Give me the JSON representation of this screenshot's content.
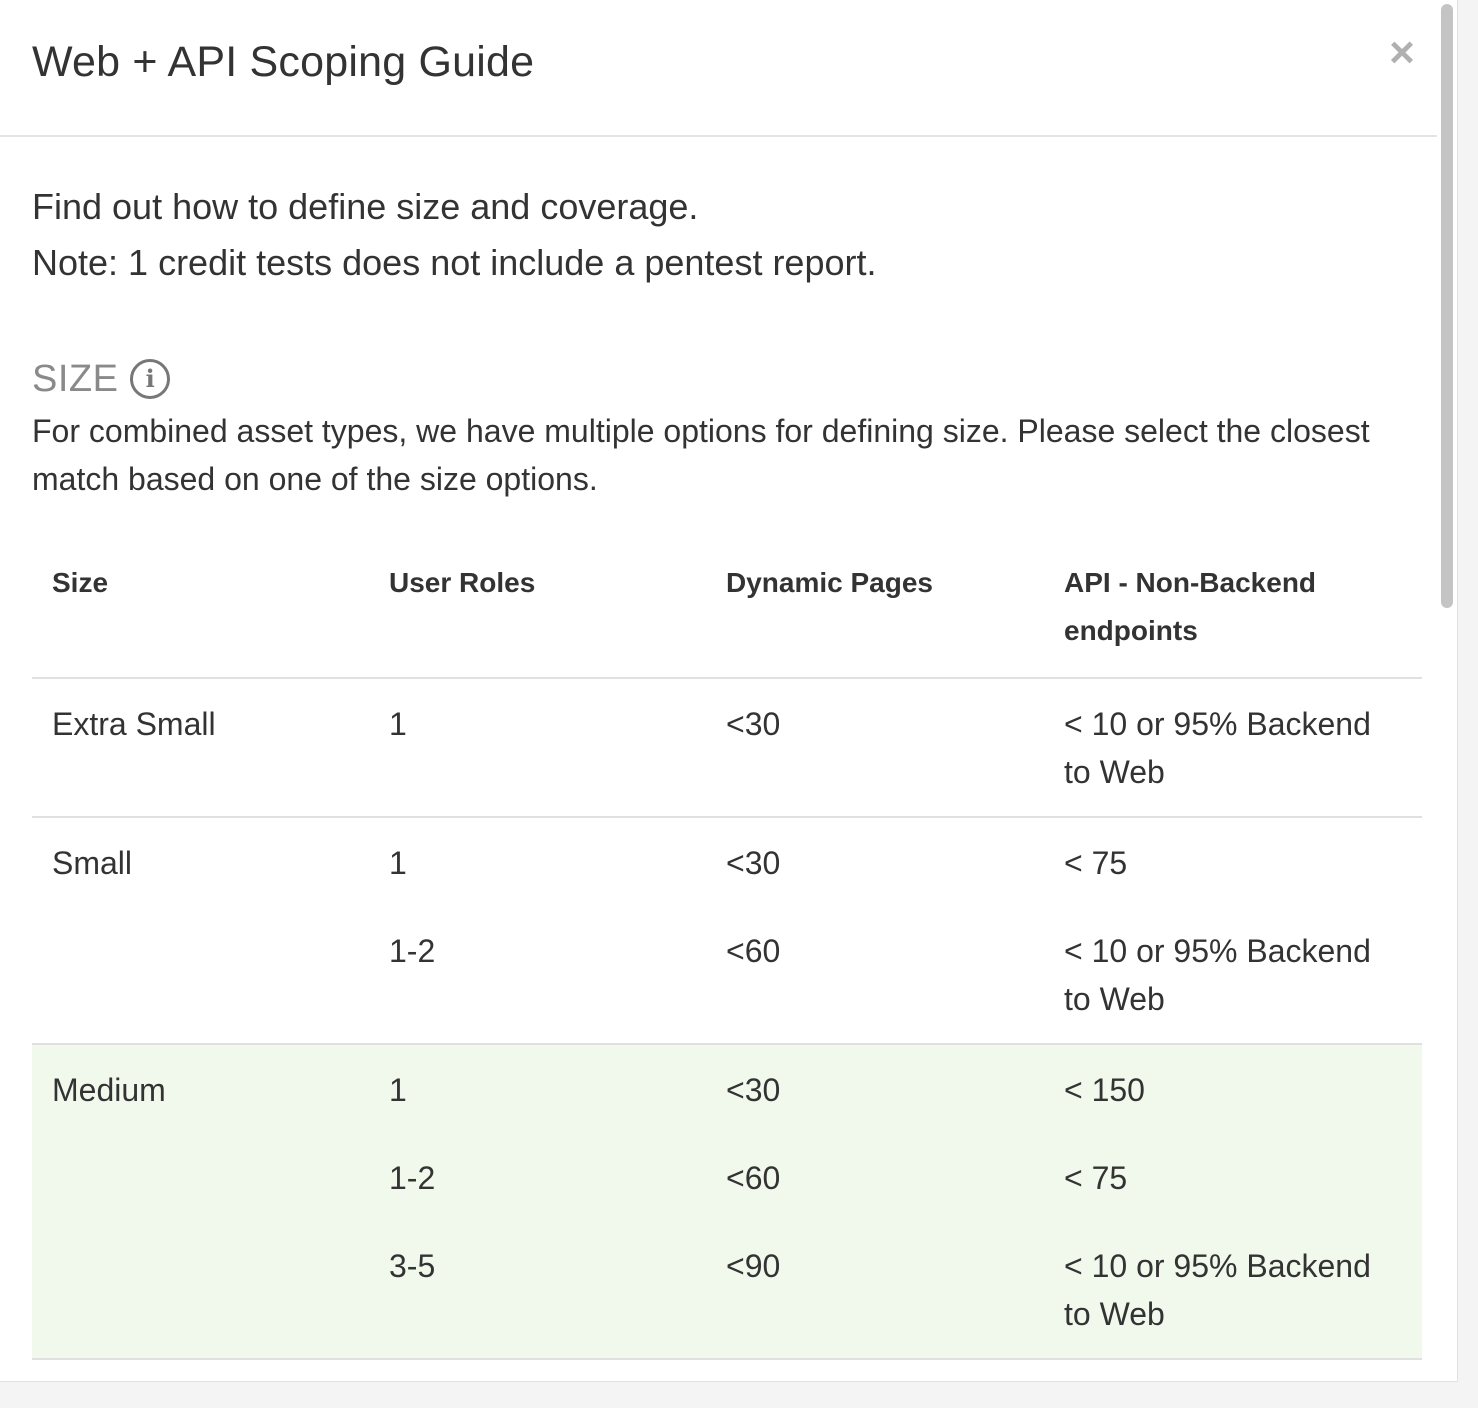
{
  "modal": {
    "title": "Web + API Scoping Guide",
    "close_label": "×"
  },
  "intro": {
    "line1": "Find out how to define size and coverage.",
    "line2": "Note: 1 credit tests does not include a pentest report."
  },
  "size_section": {
    "heading": "SIZE",
    "info_icon_glyph": "i",
    "description": "For combined asset types, we have multiple options for defining size. Please select the closest match based on one of the size options."
  },
  "table": {
    "headers": [
      "Size",
      "User Roles",
      "Dynamic Pages",
      "API - Non-Backend endpoints"
    ],
    "groups": [
      {
        "size": "Extra Small",
        "rows": [
          {
            "user_roles": "1",
            "dynamic_pages": "<30",
            "api": "< 10 or 95% Backend to Web"
          }
        ]
      },
      {
        "size": "Small",
        "rows": [
          {
            "user_roles": "1",
            "dynamic_pages": "<30",
            "api": "< 75"
          },
          {
            "user_roles": "1-2",
            "dynamic_pages": "<60",
            "api": "< 10 or 95% Backend to Web"
          }
        ]
      },
      {
        "size": "Medium",
        "highlighted": true,
        "rows": [
          {
            "user_roles": "1",
            "dynamic_pages": "<30",
            "api": "< 150"
          },
          {
            "user_roles": "1-2",
            "dynamic_pages": "<60",
            "api": "< 75"
          },
          {
            "user_roles": "3-5",
            "dynamic_pages": "<90",
            "api": "< 10 or 95% Backend to Web"
          }
        ]
      }
    ]
  },
  "colors": {
    "highlight_row": "#f1f9ec",
    "muted_heading": "#8a8a8a",
    "text": "#333333"
  }
}
